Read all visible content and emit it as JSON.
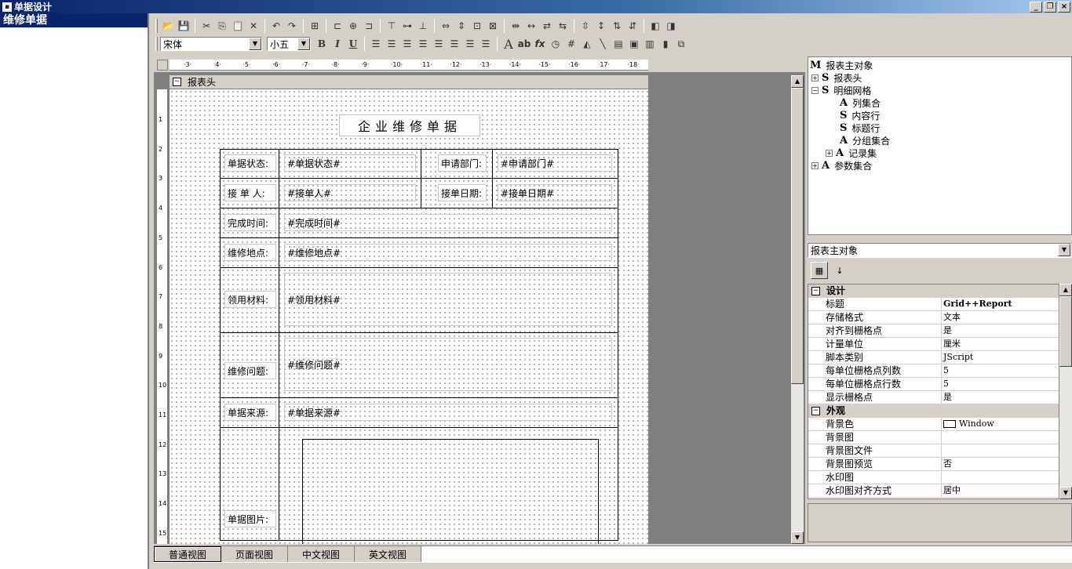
{
  "window": {
    "title": "单据设计"
  },
  "left_panel": {
    "items": [
      {
        "label": "维修单据"
      }
    ]
  },
  "toolbar2": {
    "font_name": "宋体",
    "font_size": "小五",
    "bold": "B",
    "italic": "I",
    "underline": "U"
  },
  "ruler": {
    "h_ticks": [
      "3",
      "4",
      "5",
      "6",
      "7",
      "8",
      "9",
      "10",
      "11",
      "12",
      "13",
      "14",
      "15",
      "16",
      "17",
      "18"
    ],
    "v_ticks": [
      "1",
      "2",
      "3",
      "4",
      "5",
      "6",
      "7",
      "8",
      "9",
      "10",
      "11",
      "12",
      "13",
      "14",
      "15"
    ]
  },
  "band": {
    "label": "报表头"
  },
  "report": {
    "title": "企业维修单据",
    "fields": {
      "status_label": "单据状态:",
      "status_value": "#单据状态#",
      "dept_label": "申请部门:",
      "dept_value": "#申请部门#",
      "receiver_label": "接 单 人:",
      "receiver_value": "#接单人#",
      "date_label": "接单日期:",
      "date_value": "#接单日期#",
      "finish_label": "完成时间:",
      "finish_value": "#完成时间#",
      "place_label": "维修地点:",
      "place_value": "#维修地点#",
      "material_label": "领用材料:",
      "material_value": "#领用材料#",
      "problem_label": "维修问题:",
      "problem_value": "#维修问题#",
      "source_label": "单据来源:",
      "source_value": "#单据来源#",
      "image_label": "单据图片:"
    }
  },
  "tabs": [
    {
      "label": "普通视图"
    },
    {
      "label": "页面视图"
    },
    {
      "label": "中文视图"
    },
    {
      "label": "英文视图"
    }
  ],
  "tree": {
    "root": {
      "icon": "M",
      "label": "报表主对象"
    },
    "nodes": [
      {
        "icon": "S",
        "label": "报表头"
      },
      {
        "icon": "S",
        "label": "明细网格"
      },
      {
        "icon": "A",
        "label": "列集合"
      },
      {
        "icon": "S",
        "label": "内容行"
      },
      {
        "icon": "S",
        "label": "标题行"
      },
      {
        "icon": "A",
        "label": "分组集合"
      },
      {
        "icon": "A",
        "label": "记录集"
      },
      {
        "icon": "A",
        "label": "参数集合"
      }
    ]
  },
  "object_select": {
    "value": "报表主对象"
  },
  "properties": {
    "cat_design": "设计",
    "rows_design": [
      {
        "name": "标题",
        "value": "Grid++Report"
      },
      {
        "name": "存储格式",
        "value": "文本"
      },
      {
        "name": "对齐到栅格点",
        "value": "是"
      },
      {
        "name": "计量单位",
        "value": "厘米"
      },
      {
        "name": "脚本类别",
        "value": "JScript"
      },
      {
        "name": "每单位栅格点列数",
        "value": "5"
      },
      {
        "name": "每单位栅格点行数",
        "value": "5"
      },
      {
        "name": "显示栅格点",
        "value": "是"
      }
    ],
    "cat_appearance": "外观",
    "rows_appearance": [
      {
        "name": "背景色",
        "value": "Window"
      },
      {
        "name": "背景图",
        "value": ""
      },
      {
        "name": "背景图文件",
        "value": ""
      },
      {
        "name": "背景图预览",
        "value": "否"
      },
      {
        "name": "水印图",
        "value": ""
      },
      {
        "name": "水印图对齐方式",
        "value": "居中"
      }
    ]
  }
}
